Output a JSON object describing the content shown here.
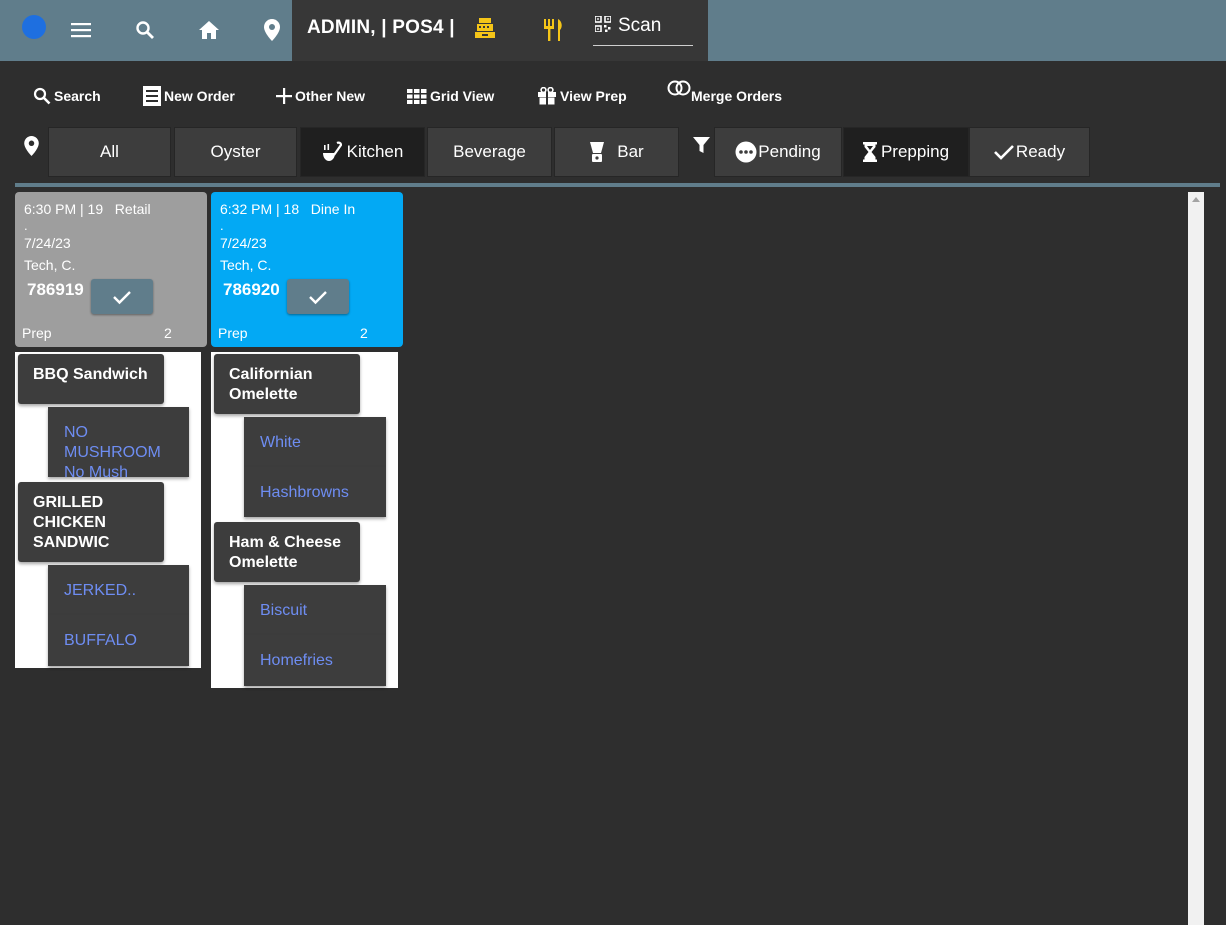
{
  "header": {
    "title": "ADMIN, | POS4 |",
    "scan_label": "Scan",
    "icons": [
      "menu-icon",
      "search-icon",
      "home-icon",
      "location-pin-icon",
      "cash-register-icon",
      "utensils-icon",
      "qr-code-icon"
    ],
    "accent_color": "#f5c518",
    "bar_color": "#607d8b"
  },
  "toolbar": {
    "search": "Search",
    "new_order": "New Order",
    "other_new": "Other New",
    "grid_view": "Grid View",
    "view_prep": "View Prep",
    "merge_orders": "Merge Orders"
  },
  "stations": {
    "all": "All",
    "oyster": "Oyster",
    "kitchen": "Kitchen",
    "beverage": "Beverage",
    "bar": "Bar",
    "active": "Kitchen"
  },
  "status_filters": {
    "pending": "Pending",
    "prepping": "Prepping",
    "ready": "Ready",
    "active": "Prepping"
  },
  "tickets": [
    {
      "line1": "6:30 PM | 19   Retail",
      "dot": ".",
      "date": "7/24/23",
      "server": "Tech, C.",
      "number": "786919",
      "status": "Prep",
      "count": "2",
      "color": "#9e9e9e",
      "items": [
        {
          "name": "BBQ Sandwich",
          "mods": [
            "NO MUSHROOM\nNo Mush"
          ]
        },
        {
          "name": "GRILLED\nCHICKEN\nSANDWIC",
          "mods": [
            "JERKED..",
            "BUFFALO"
          ]
        }
      ]
    },
    {
      "line1": "6:32 PM | 18   Dine In",
      "dot": ".",
      "date": "7/24/23",
      "server": "Tech, C.",
      "number": "786920",
      "status": "Prep",
      "count": "2",
      "color": "#03a9f4",
      "items": [
        {
          "name": "Californian\nOmelette",
          "mods": [
            "White",
            "Hashbrowns"
          ]
        },
        {
          "name": "Ham & Cheese\nOmelette",
          "mods": [
            "Biscuit",
            "Homefries"
          ]
        }
      ]
    }
  ]
}
